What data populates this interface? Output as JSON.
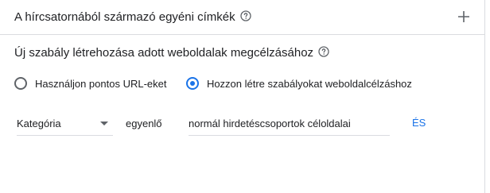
{
  "section": {
    "title": "A hírcsatornából származó egyéni címkék",
    "help_icon": "help-circle-icon",
    "add_icon": "plus-icon"
  },
  "rule": {
    "title": "Új szabály létrehozása adott weboldalak megcélzásához",
    "help_icon": "help-circle-icon"
  },
  "radios": [
    {
      "label": "Használjon pontos URL-eket",
      "selected": false
    },
    {
      "label": "Hozzon létre szabályokat weboldalcélzáshoz",
      "selected": true
    }
  ],
  "condition": {
    "field": "Kategória",
    "operator": "egyenlő",
    "value": "normál hirdetéscsoportok céloldalai",
    "and_label": "ÉS"
  },
  "colors": {
    "accent": "#1a73e8",
    "text": "#202124",
    "icon": "#5f6368",
    "divider": "#dadce0"
  }
}
